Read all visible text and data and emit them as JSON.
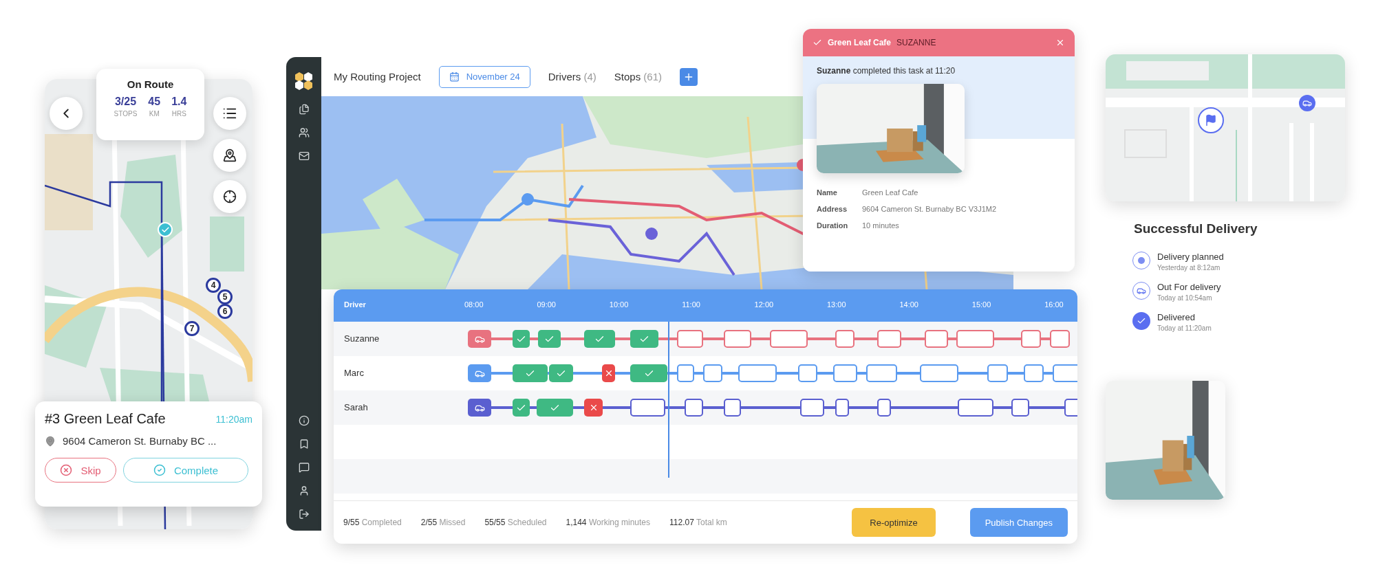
{
  "mobile": {
    "status": {
      "title": "On Route",
      "stats": [
        {
          "value": "3/25",
          "label": "STOPS"
        },
        {
          "value": "45",
          "label": "KM"
        },
        {
          "value": "1.4",
          "label": "HRS"
        }
      ]
    },
    "stops": [
      {
        "kind": "done"
      },
      {
        "kind": "number",
        "label": "4"
      },
      {
        "kind": "number",
        "label": "5"
      },
      {
        "kind": "number",
        "label": "6"
      },
      {
        "kind": "number",
        "label": "7"
      }
    ],
    "task": {
      "title": "#3 Green Leaf Cafe",
      "time": "11:20am",
      "address": "9604 Cameron St. Burnaby BC ...",
      "buttons": [
        {
          "kind": "skip",
          "label": "Skip"
        },
        {
          "kind": "complete",
          "label": "Complete"
        }
      ]
    }
  },
  "topbar": {
    "project": "My Routing Project",
    "date": "November 24",
    "tabs": [
      {
        "label": "Drivers",
        "count": "(4)"
      },
      {
        "label": "Stops",
        "count": "(61)"
      }
    ]
  },
  "popup": {
    "title": "Green Leaf Cafe",
    "driver": "SUZANNE",
    "message": "**Suzanne** completed this task at 11:20",
    "details": [
      {
        "label": "Name",
        "value": "Green Leaf Cafe"
      },
      {
        "label": "Address",
        "value": "9604 Cameron St. Burnaby BC V3J1M2"
      },
      {
        "label": "Duration",
        "value": "10 minutes"
      }
    ]
  },
  "schedule": {
    "header": "Driver",
    "hours": [
      "08:00",
      "09:00",
      "10:00",
      "11:00",
      "12:00",
      "13:00",
      "14:00",
      "15:00",
      "16:00"
    ],
    "drivers": [
      {
        "name": "Suzanne",
        "color": "#e8727f",
        "stops": [
          {
            "kind": "vehicle"
          },
          {
            "kind": "done"
          },
          {
            "kind": "done"
          },
          {
            "kind": "done"
          },
          {
            "kind": "done"
          },
          {
            "kind": "planned"
          },
          {
            "kind": "planned"
          },
          {
            "kind": "planned"
          },
          {
            "kind": "planned"
          },
          {
            "kind": "planned"
          },
          {
            "kind": "planned"
          },
          {
            "kind": "planned"
          },
          {
            "kind": "planned"
          },
          {
            "kind": "planned"
          }
        ]
      },
      {
        "name": "Marc",
        "color": "#5b9bf0",
        "stops": [
          {
            "kind": "vehicle"
          },
          {
            "kind": "done"
          },
          {
            "kind": "done"
          },
          {
            "kind": "missed"
          },
          {
            "kind": "done"
          },
          {
            "kind": "planned"
          },
          {
            "kind": "planned"
          },
          {
            "kind": "planned"
          },
          {
            "kind": "planned"
          },
          {
            "kind": "planned"
          },
          {
            "kind": "planned"
          },
          {
            "kind": "planned"
          },
          {
            "kind": "planned"
          },
          {
            "kind": "planned"
          },
          {
            "kind": "planned"
          }
        ]
      },
      {
        "name": "Sarah",
        "color": "#5a5fd0",
        "stops": [
          {
            "kind": "vehicle"
          },
          {
            "kind": "done"
          },
          {
            "kind": "done"
          },
          {
            "kind": "missed"
          },
          {
            "kind": "planned"
          },
          {
            "kind": "planned"
          },
          {
            "kind": "planned"
          },
          {
            "kind": "planned"
          },
          {
            "kind": "planned"
          },
          {
            "kind": "planned"
          },
          {
            "kind": "planned"
          },
          {
            "kind": "planned"
          },
          {
            "kind": "planned"
          }
        ]
      }
    ],
    "summary": [
      "**9/55** Completed",
      "**2/55** Missed",
      "**55/55** Scheduled",
      "**1,144** Working minutes",
      "**112.07** Total km"
    ],
    "buttons": [
      {
        "kind": "secondary",
        "label": "Re-optimize"
      },
      {
        "kind": "primary",
        "label": "Publish Changes"
      }
    ]
  },
  "tracking": {
    "title": "Successful Delivery",
    "steps": [
      {
        "kind": "planned",
        "label": "Delivery planned",
        "time": "Yesterday at 8:12am"
      },
      {
        "kind": "transit",
        "label": "Out For delivery",
        "time": "Today at 10:54am"
      },
      {
        "kind": "delivered",
        "label": "Delivered",
        "time": "Today at 11:20am"
      }
    ]
  }
}
